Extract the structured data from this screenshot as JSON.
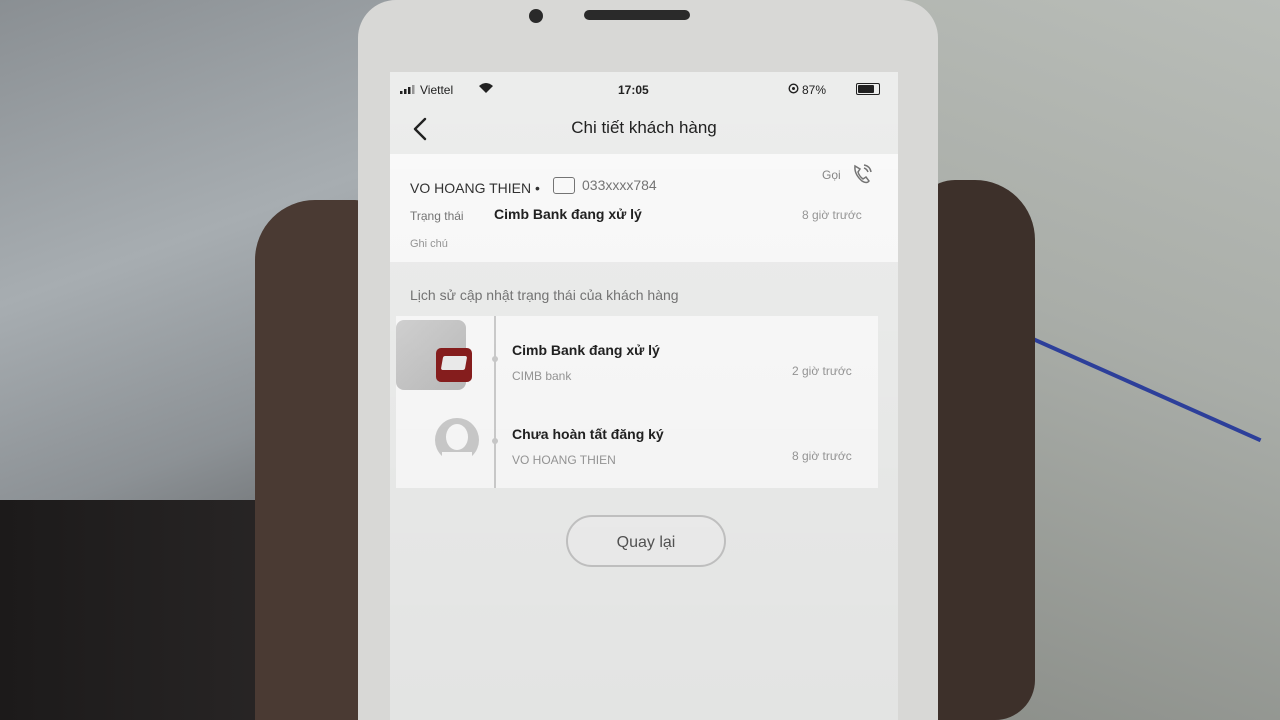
{
  "status_bar": {
    "carrier": "Viettel",
    "time": "17:05",
    "battery": "87%",
    "battery_level": 0.87
  },
  "header": {
    "title": "Chi tiết khách hàng",
    "back_icon": "chevron-left-icon"
  },
  "customer": {
    "name": "VO HOANG THIEN",
    "separator": "•",
    "phone": "033xxxx784",
    "call_label": "Gọi",
    "call_icon": "phone-call-icon",
    "status_label": "Trạng thái",
    "status_value": "Cimb Bank đang xử lý",
    "status_time": "8 giờ trước",
    "note_label": "Ghi chú"
  },
  "history": {
    "title": "Lịch sử cập nhật trạng thái của khách hàng",
    "items": [
      {
        "title": "Cimb Bank đang xử lý",
        "subtitle": "CIMB bank",
        "time": "2 giờ trước",
        "avatar": "cimb-bank-logo"
      },
      {
        "title": "Chưa hoàn tất đăng ký",
        "subtitle": "VO HOANG THIEN",
        "time": "8 giờ trước",
        "avatar": "user-avatar-icon"
      }
    ]
  },
  "actions": {
    "back_label": "Quay lại"
  }
}
